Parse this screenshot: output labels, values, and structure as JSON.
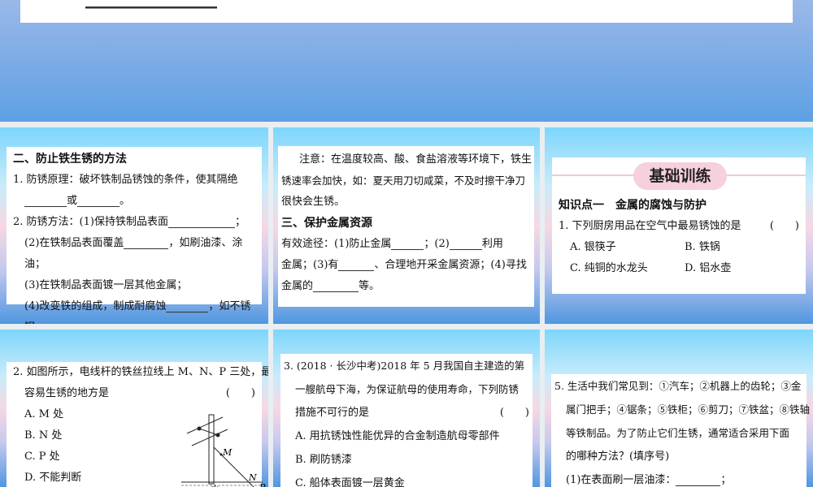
{
  "p1": {
    "heading": "二、防止铁生锈的方法",
    "l1": "1. 防锈原理：破坏铁制品锈蚀的条件，使其隔绝",
    "l2_or": "或",
    "l2_end": "。",
    "l3": "2. 防锈方法：(1)保持铁制品表面",
    "l3_end": "；",
    "l4": "(2)在铁制品表面覆盖",
    "l4_end": "，如刷油漆、涂油；",
    "l5": "(3)在铁制品表面镀一层其他金属；",
    "l6": "(4)改变铁的组成，制成耐腐蚀",
    "l6_end": "，如不锈钢。"
  },
  "p2": {
    "note1": "注意：在温度较高、酸、食盐溶液等环境下，铁生",
    "note2": "锈速率会加快，如：夏天用刀切咸菜，不及时擦干净刀",
    "note3": "很快会生锈。",
    "heading": "三、保护金属资源",
    "l1a": "有效途径：(1)防止金属",
    "l1b": "；(2)",
    "l1c": "利用",
    "l2a": "金属；(3)有",
    "l2b": "、合理地开采金属资源；(4)寻找",
    "l3a": "金属的",
    "l3b": "等。"
  },
  "p3": {
    "banner": "基础训练",
    "kp": "知识点一　金属的腐蚀与防护",
    "q": "1. 下列厨房用品在空气中最易锈蚀的是",
    "paren": "(　　)",
    "options": [
      "A. 银筷子",
      "B. 铁锅",
      "C. 纯铜的水龙头",
      "D. 铝水壶"
    ]
  },
  "p4": {
    "q1": "2. 如图所示，电线杆的铁丝拉线上 M、N、P 三处，最",
    "q2": "容易生锈的地方是",
    "paren": "(　　)",
    "options": [
      "A. M 处",
      "B. N 处",
      "C. P 处",
      "D. 不能判断"
    ],
    "fig": {
      "m": "M",
      "n": "N",
      "p": "P",
      "water": "水"
    }
  },
  "p5": {
    "q1": "3. (2018 · 长沙中考)2018 年 5 月我国自主建造的第",
    "q2": "一艘航母下海，为保证航母的使用寿命，下列防锈",
    "q3": "措施不可行的是",
    "paren": "(　　)",
    "options": [
      "A. 用抗锈蚀性能优异的合金制造航母零部件",
      "B. 刷防锈漆",
      "C. 船体表面镀一层黄金"
    ]
  },
  "p6": {
    "q1": "5. 生活中我们常见到：①汽车；②机器上的齿轮；③金",
    "q2": "属门把手；④锯条；⑤铁柜；⑥剪刀；⑦铁盆；⑧铁轴",
    "q3": "等铁制品。为了防止它们生锈，通常适合采用下面",
    "q4": "的哪种方法？(填序号)",
    "q5": "(1)在表面刷一层油漆：",
    "q5_end": "；"
  }
}
